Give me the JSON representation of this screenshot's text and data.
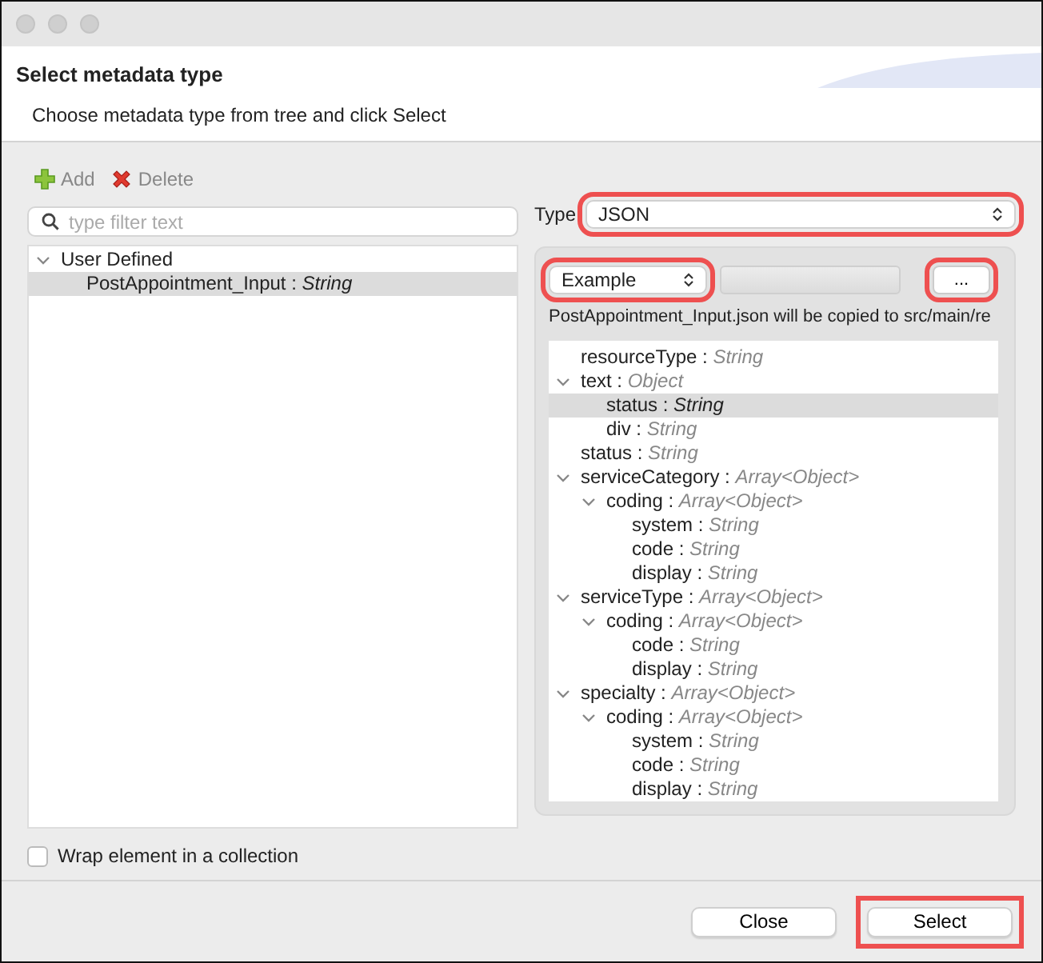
{
  "header": {
    "title": "Select metadata type",
    "subtitle": "Choose metadata type from tree and click Select"
  },
  "toolbar": [
    {
      "kind": "add",
      "label": "Add"
    },
    {
      "kind": "delete",
      "label": "Delete"
    }
  ],
  "filter": {
    "placeholder": "type filter text"
  },
  "left_tree": [
    {
      "label": "User Defined",
      "expanded": true,
      "selected": false,
      "children": [
        {
          "label": "PostAppointment_Input : *String*",
          "selected": true
        }
      ]
    }
  ],
  "type_field": {
    "label": "Type",
    "value": "JSON",
    "highlighted": true
  },
  "source_select": {
    "value": "Example",
    "highlighted": true
  },
  "browse_button": {
    "label": "...",
    "highlighted": true
  },
  "copy_note": "PostAppointment_Input.json will be copied to src/main/re",
  "schema_tree": [
    {
      "label": "resourceType : *String*",
      "selected": false
    },
    {
      "label": "text : *Object*",
      "expanded": true,
      "selected": false,
      "children": [
        {
          "label": "status : *String*",
          "selected": true
        },
        {
          "label": "div : *String*",
          "selected": false
        }
      ]
    },
    {
      "label": "status : *String*",
      "selected": false
    },
    {
      "label": "serviceCategory : *Array<Object>*",
      "expanded": true,
      "selected": false,
      "children": [
        {
          "label": "coding : *Array<Object>*",
          "expanded": true,
          "selected": false,
          "children": [
            {
              "label": "system : *String*",
              "selected": false
            },
            {
              "label": "code : *String*",
              "selected": false
            },
            {
              "label": "display : *String*",
              "selected": false
            }
          ]
        }
      ]
    },
    {
      "label": "serviceType : *Array<Object>*",
      "expanded": true,
      "selected": false,
      "children": [
        {
          "label": "coding : *Array<Object>*",
          "expanded": true,
          "selected": false,
          "children": [
            {
              "label": "code : *String*",
              "selected": false
            },
            {
              "label": "display : *String*",
              "selected": false
            }
          ]
        }
      ]
    },
    {
      "label": "specialty : *Array<Object>*",
      "expanded": true,
      "selected": false,
      "children": [
        {
          "label": "coding : *Array<Object>*",
          "expanded": true,
          "selected": false,
          "children": [
            {
              "label": "system : *String*",
              "selected": false
            },
            {
              "label": "code : *String*",
              "selected": false
            },
            {
              "label": "display : *String*",
              "selected": false
            }
          ]
        }
      ]
    }
  ],
  "wrap_checkbox": {
    "label": "Wrap element in a collection",
    "checked": false
  },
  "buttons": [
    {
      "label": "Close",
      "highlighted": false
    },
    {
      "label": "Select",
      "highlighted": true
    }
  ]
}
